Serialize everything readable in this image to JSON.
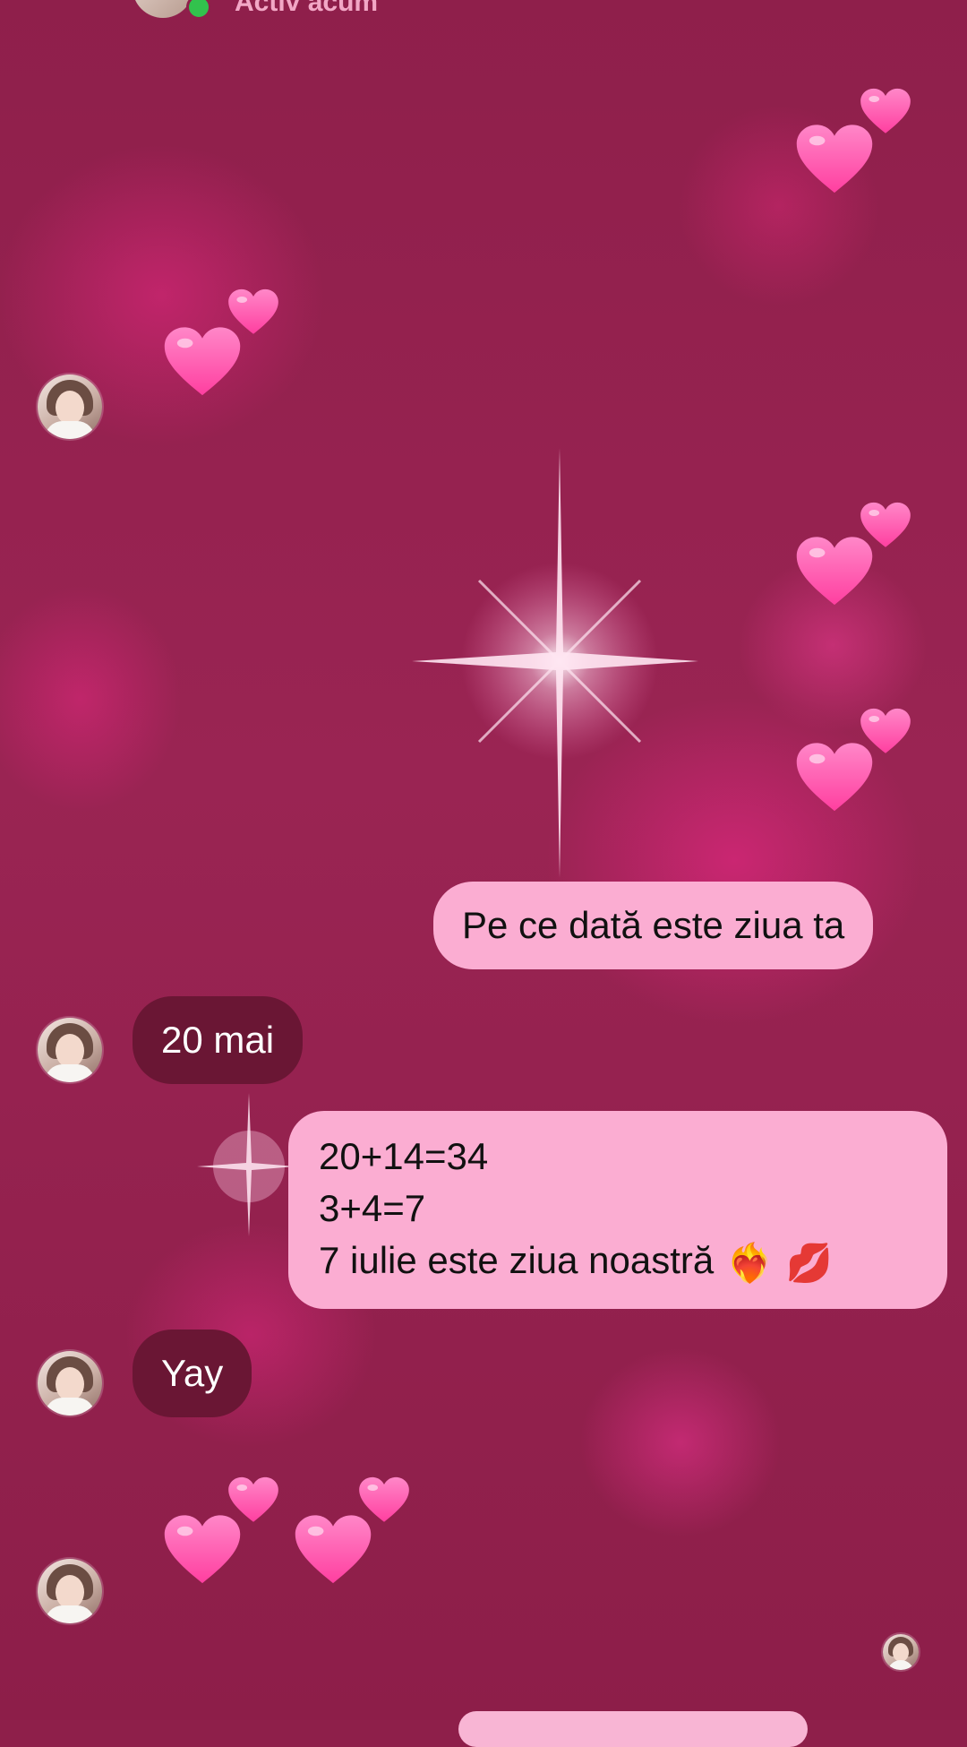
{
  "header": {
    "status": "Activ acum"
  },
  "messages": [
    {
      "direction": "incoming",
      "type": "hearts",
      "text": "💕"
    },
    {
      "direction": "outgoing",
      "type": "hearts",
      "text": "💕"
    },
    {
      "direction": "outgoing",
      "type": "hearts",
      "text": "💕"
    },
    {
      "direction": "outgoing",
      "type": "hearts",
      "text": "💕"
    },
    {
      "direction": "outgoing",
      "type": "text",
      "text": "Pe ce dată este ziua ta"
    },
    {
      "direction": "incoming",
      "type": "text",
      "text": "20 mai"
    },
    {
      "direction": "outgoing",
      "type": "text",
      "lines": [
        "20+14=34",
        "3+4=7",
        "7 iulie este ziua noastră"
      ],
      "emojis": [
        "❤️‍🔥",
        "💋"
      ]
    },
    {
      "direction": "incoming",
      "type": "text",
      "text": "Yay"
    },
    {
      "direction": "incoming",
      "type": "hearts",
      "text": "💕💕"
    }
  ],
  "colors": {
    "background": "#8f1f4b",
    "outgoing_bubble": "#fbadd2",
    "incoming_bubble": "#6a1634",
    "heart": "#ff5fb0",
    "online": "#32c24d"
  },
  "icons": [
    "two-hearts-icon",
    "heart-on-fire-icon",
    "kiss-mark-icon",
    "sparkle-icon",
    "online-dot-icon"
  ]
}
